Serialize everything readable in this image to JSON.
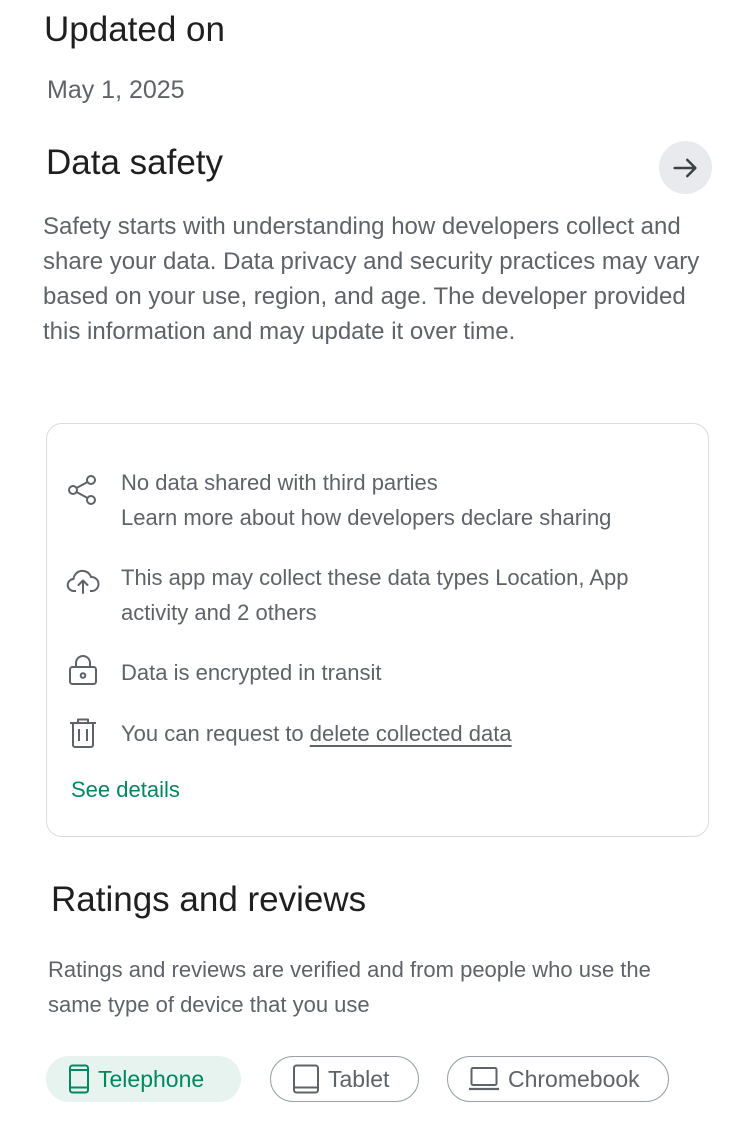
{
  "updated": {
    "heading": "Updated on",
    "date": "May 1, 2025"
  },
  "data_safety": {
    "heading": "Data safety",
    "arrow_icon": "arrow-right-icon",
    "description": "Safety starts with understanding how developers collect and share your data. Data privacy and security practices may vary based on your use, region, and age. The developer provided this information and may update it over time.",
    "items": [
      {
        "icon": "share-icon",
        "line1": "No data shared with third parties",
        "line2": "Learn more about how developers declare sharing"
      },
      {
        "icon": "cloud-upload-icon",
        "line1": "This app may collect these data types Location, App",
        "line2": "activity and 2 others"
      },
      {
        "icon": "lock-icon",
        "line1": "Data is encrypted in transit"
      },
      {
        "icon": "trash-icon",
        "prefix": "You can request to ",
        "link": "delete collected data"
      }
    ],
    "see_details": "See details"
  },
  "ratings": {
    "heading": "Ratings and reviews",
    "description": "Ratings and reviews are verified and from people who use the same type of device that you use",
    "chips": [
      {
        "label": "Telephone",
        "icon": "phone-icon",
        "selected": true
      },
      {
        "label": "Tablet",
        "icon": "tablet-icon",
        "selected": false
      },
      {
        "label": "Chromebook",
        "icon": "laptop-icon",
        "selected": false
      }
    ]
  },
  "colors": {
    "accent": "#01875f",
    "selected_chip_bg": "#e6f3ef",
    "secondary_text": "#5f6368"
  }
}
